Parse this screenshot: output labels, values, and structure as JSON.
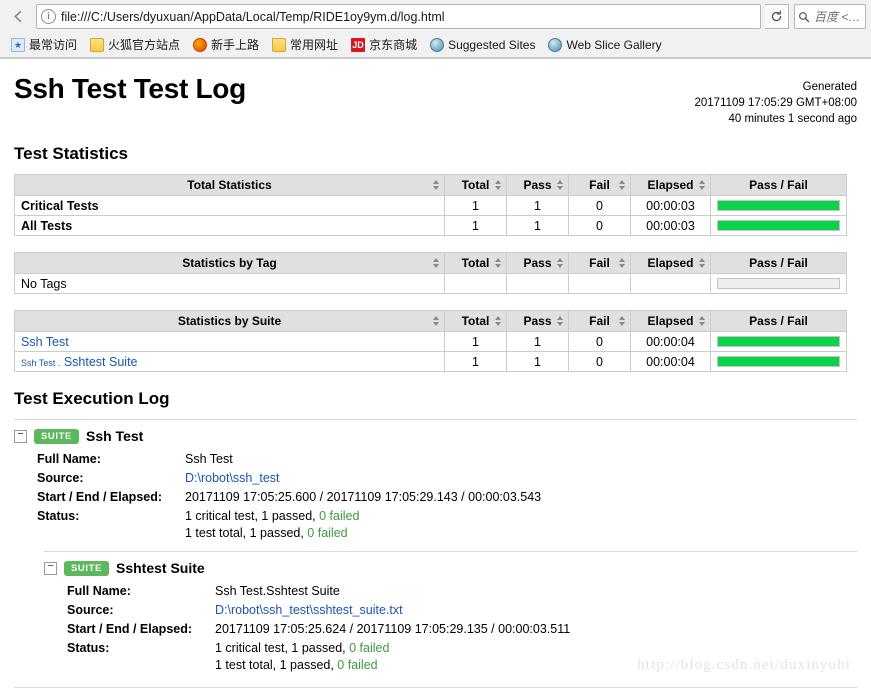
{
  "browser": {
    "back_label": "←",
    "info_icon_label": "i",
    "url": "file:///C:/Users/dyuxuan/AppData/Local/Temp/RIDE1oy9ym.d/log.html",
    "reload_label": "↻",
    "search_icon_label": "⌕",
    "search_placeholder": "百度 <…",
    "bookmarks": [
      {
        "label": "最常访问",
        "icon": "star-icon"
      },
      {
        "label": "火狐官方站点",
        "icon": "folder-icon"
      },
      {
        "label": "新手上路",
        "icon": "firefox-icon"
      },
      {
        "label": "常用网址",
        "icon": "folder-icon"
      },
      {
        "label": "京东商城",
        "icon": "jd-icon"
      },
      {
        "label": "Suggested Sites",
        "icon": "globe-icon"
      },
      {
        "label": "Web Slice Gallery",
        "icon": "globe-icon"
      }
    ]
  },
  "report": {
    "title": "Ssh Test Test Log",
    "generated_label": "Generated",
    "generated_time": "20171109 17:05:29 GMT+08:00",
    "generated_ago": "40 minutes 1 second ago",
    "statistics_heading": "Test Statistics",
    "execution_heading": "Test Execution Log",
    "watermark": "http://blog.csdn.net/duxinyuhi"
  },
  "columns": {
    "total": "Total",
    "pass": "Pass",
    "fail": "Fail",
    "elapsed": "Elapsed",
    "passfail": "Pass / Fail"
  },
  "tables": [
    {
      "name_header": "Total Statistics",
      "rows": [
        {
          "label": "Critical Tests",
          "bold": true,
          "link": false,
          "total": "1",
          "pass": "1",
          "fail": "0",
          "elapsed": "00:00:03",
          "pass_pct": 100,
          "has_bar": true
        },
        {
          "label": "All Tests",
          "bold": true,
          "link": false,
          "total": "1",
          "pass": "1",
          "fail": "0",
          "elapsed": "00:00:03",
          "pass_pct": 100,
          "has_bar": true
        }
      ]
    },
    {
      "name_header": "Statistics by Tag",
      "rows": [
        {
          "label": "No Tags",
          "bold": false,
          "link": false,
          "total": "",
          "pass": "",
          "fail": "",
          "elapsed": "",
          "pass_pct": 0,
          "has_bar": true
        }
      ]
    },
    {
      "name_header": "Statistics by Suite",
      "rows": [
        {
          "label": "Ssh Test",
          "prefix": "",
          "bold": false,
          "link": true,
          "total": "1",
          "pass": "1",
          "fail": "0",
          "elapsed": "00:00:04",
          "pass_pct": 100,
          "has_bar": true
        },
        {
          "label": "Sshtest Suite",
          "prefix": "Ssh Test .",
          "bold": false,
          "link": true,
          "total": "1",
          "pass": "1",
          "fail": "0",
          "elapsed": "00:00:04",
          "pass_pct": 100,
          "has_bar": true
        }
      ]
    }
  ],
  "exec_log": {
    "toggle_label": "−",
    "badge_label": "SUITE",
    "keys": {
      "full_name": "Full Name:",
      "source": "Source:",
      "start_end_elapsed": "Start / End / Elapsed:",
      "status": "Status:"
    },
    "suites": [
      {
        "name": "Ssh Test",
        "full_name": "Ssh Test",
        "source": "D:\\robot\\ssh_test",
        "times": "20171109 17:05:25.600 / 20171109 17:05:29.143 / 00:00:03.543",
        "status_line1_a": "1 critical test, 1 passed, ",
        "status_line1_b": "0 failed",
        "status_line2_a": "1 test total, 1 passed, ",
        "status_line2_b": "0 failed"
      },
      {
        "name": "Sshtest Suite",
        "full_name": "Ssh Test.Sshtest Suite",
        "source": "D:\\robot\\ssh_test\\sshtest_suite.txt",
        "times": "20171109 17:05:25.624 / 20171109 17:05:29.135 / 00:00:03.511",
        "status_line1_a": "1 critical test, 1 passed, ",
        "status_line1_b": "0 failed",
        "status_line2_a": "1 test total, 1 passed, ",
        "status_line2_b": "0 failed"
      }
    ]
  },
  "colors": {
    "pass_green": "#0ad24a",
    "badge_green": "#5cb85c",
    "link_blue": "#1a56b0",
    "failed_zero_green": "#3f9a3f"
  }
}
